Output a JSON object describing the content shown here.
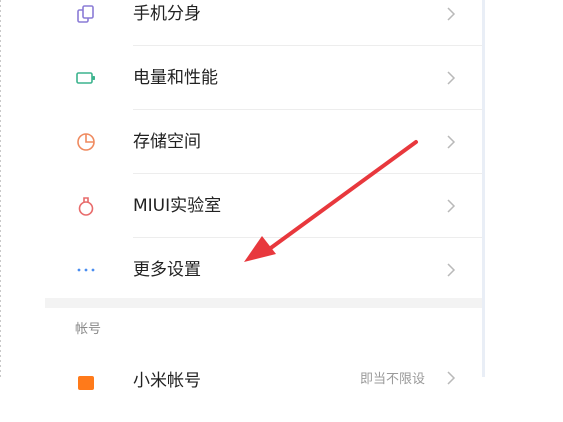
{
  "settings": {
    "items": [
      {
        "label": "手机分身",
        "icon": "clone-icon",
        "color": "#8a7bd6"
      },
      {
        "label": "电量和性能",
        "icon": "battery-icon",
        "color": "#3bb38d"
      },
      {
        "label": "存储空间",
        "icon": "pie-chart-icon",
        "color": "#ef8a5f"
      },
      {
        "label": "MIUI实验室",
        "icon": "flask-icon",
        "color": "#e86b6b"
      },
      {
        "label": "更多设置",
        "icon": "more-dots-icon",
        "color": "#4a8df0"
      }
    ],
    "account_section": {
      "title": "帐号",
      "first_item": {
        "label": "小米帐号",
        "value": "即当不限设"
      }
    }
  },
  "annotation": {
    "arrow_color": "#e8383d"
  }
}
